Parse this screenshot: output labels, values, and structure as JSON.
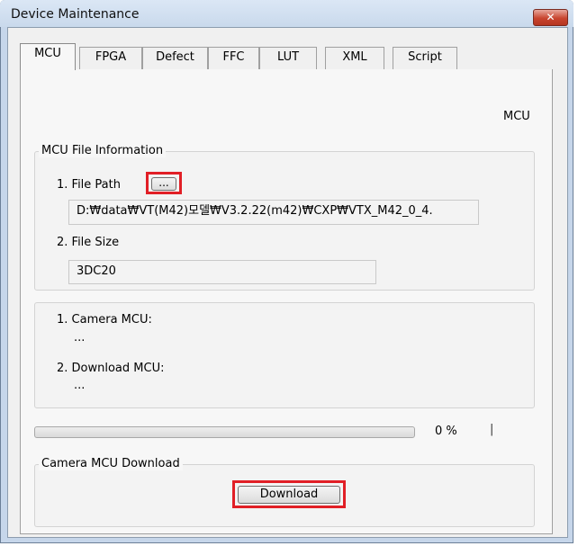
{
  "window": {
    "title": "Device Maintenance",
    "close_label": "✕"
  },
  "tabs": [
    {
      "label": "MCU",
      "active": true
    },
    {
      "label": "FPGA"
    },
    {
      "label": "Defect"
    },
    {
      "label": "FFC"
    },
    {
      "label": "LUT"
    },
    {
      "label": "XML"
    },
    {
      "label": "Script"
    }
  ],
  "mcu_header": "MCU",
  "file_info": {
    "legend": "MCU File Information",
    "file_path_label": "1. File Path",
    "browse_label": "...",
    "file_path_value": "D:₩data₩VT(M42)모델₩V3.2.22(m42)₩CXP₩VTX_M42_0_4.",
    "file_size_label": "2. File Size",
    "file_size_value": "3DC20"
  },
  "mcu_versions": {
    "camera_label": "1. Camera MCU:",
    "camera_value": "...",
    "download_label": "2. Download MCU:",
    "download_value": "..."
  },
  "progress": {
    "value_percent": 0,
    "text": "0 %",
    "marker": "|"
  },
  "download_group": {
    "legend": "Camera MCU Download",
    "button_label": "Download"
  },
  "colors": {
    "highlight": "#e11f26",
    "window_frame": "#c6d6ea",
    "close_button": "#c8452f"
  }
}
